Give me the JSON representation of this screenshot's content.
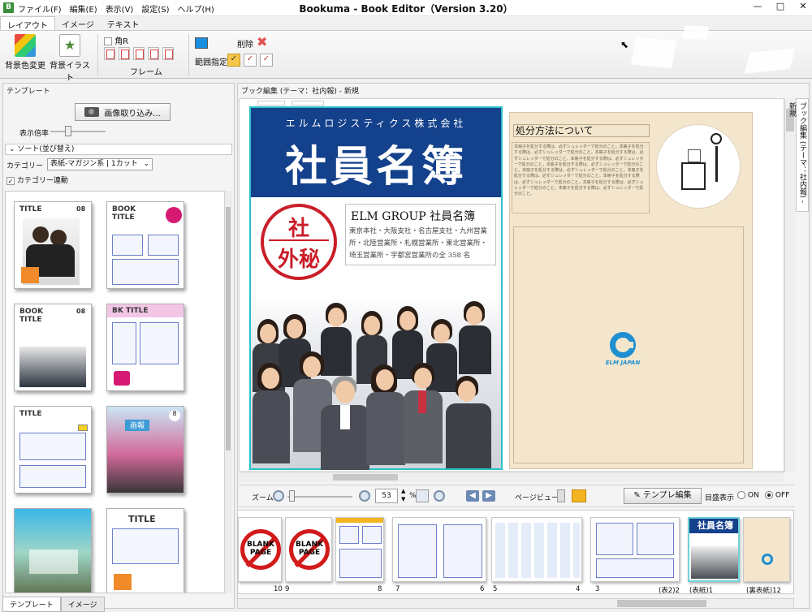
{
  "window": {
    "title": "Bookuma - Book Editor（Version 3.20）",
    "controls": [
      "—",
      "□",
      "✕"
    ]
  },
  "menu": [
    "ファイル(F)",
    "編集(E)",
    "表示(V)",
    "設定(S)",
    "ヘルプ(H)"
  ],
  "ribbon": {
    "tabs": [
      "レイアウト",
      "イメージ",
      "テキスト"
    ],
    "bg_color_label": "背景色変更",
    "bg_illust_label": "背景イラスト",
    "corner_r_label": "角R",
    "frame_label": "フレーム",
    "range_label": "範囲指定",
    "delete_label": "削除"
  },
  "left_panel": {
    "title": "テンプレート",
    "import_button": "画像取り込み...",
    "scale_label": "表示倍率",
    "sort_label": "ソート(並び替え)",
    "category_label": "カテゴリー",
    "category_value": "表紙-マガジン系 | 1カット",
    "category_link_label": "カテゴリー連動",
    "thumbnails": [
      {
        "title": "TITLE",
        "num": "08"
      },
      {
        "title": "BOOK TITLE",
        "num": ""
      },
      {
        "title": "BOOK TITLE",
        "num": "08"
      },
      {
        "title": "BK TITLE",
        "num": ""
      },
      {
        "title": "TITLE",
        "num": ""
      },
      {
        "title": "画報",
        "num": "8"
      },
      {
        "title": "",
        "num": ""
      },
      {
        "title": "TITLE",
        "num": ""
      }
    ],
    "bottom_tabs": [
      "テンプレート",
      "イメージ"
    ]
  },
  "editor": {
    "title": "ブック編集 (テーマ：社内報) - 新規",
    "vertical_tab": "ブック編集 (テーマ：社内報) - 新規",
    "cover": {
      "company": "エルムロジスティクス株式会社",
      "title": "社員名簿",
      "stamp_line1": "社",
      "stamp_line2": "外秘",
      "sub_title": "ELM GROUP 社員名簿",
      "sub_body": "東京本社・大阪支社・名古屋支社・九州営業所・北陸営業所・札幌営業所・東北営業所・埼玉営業所・宇都宮営業所の全 358 名"
    },
    "back": {
      "heading": "処分方法について",
      "body": "本冊子を処分する際は、必ずシュレッダーで処分のこと。本冊子を処分する際は、必ずシュレッダーで処分のこと。本冊子を処分する際は、必ずシュレッダーで処分のこと。本冊子を処分する際は、必ずシュレッダーで処分のこと。本冊子を処分する際は、必ずシュレッダーで処分のこと。本冊子を処分する際は、必ずシュレッダーで処分のこと。本冊子を処分する際は、必ずシュレッダーで処分のこと。本冊子を処分する際は、必ずシュレッダーで処分のこと。本冊子を処分する際は、必ずシュレッダーで処分のこと。本冊子を処分する際は、必ずシュレッダーで処分のこと。",
      "logo_text": "ELM JAPAN"
    }
  },
  "toolbar": {
    "zoom_label": "ズーム",
    "zoom_value": "53",
    "zoom_unit": "%",
    "page_view_label": "ページビュー",
    "template_edit_button": "テンプレ編集",
    "guide_label": "目盛表示",
    "on_label": "ON",
    "off_label": "OFF",
    "selected": "OFF"
  },
  "page_strip": {
    "labels": [
      "10",
      "9",
      "8",
      "7",
      "6",
      "5",
      "4",
      "3",
      "(表2)2",
      "(表紙)1",
      "(裏表紙)12"
    ],
    "blank_text": "BLANK PAGE"
  }
}
